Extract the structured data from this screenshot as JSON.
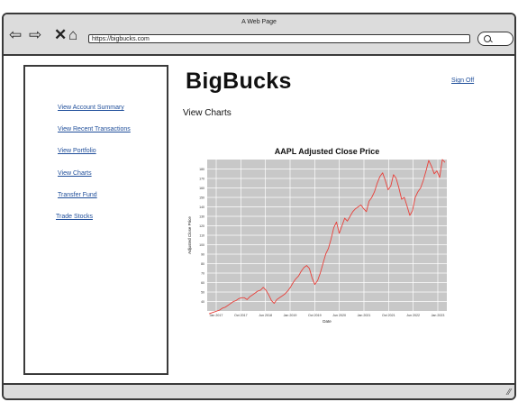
{
  "window": {
    "title": "A Web Page",
    "url": "https://bigbucks.com",
    "nav_icons": [
      "back-arrow-icon",
      "forward-arrow-icon",
      "close-icon",
      "home-icon"
    ]
  },
  "sidebar": {
    "items": [
      {
        "label": "View Account Summary"
      },
      {
        "label": "View Recent Transactions"
      },
      {
        "label": "View Portfolio"
      },
      {
        "label": "View Charts"
      },
      {
        "label": "Transfer Fund"
      },
      {
        "label": "Trade Stocks"
      }
    ]
  },
  "header": {
    "brand": "BigBucks",
    "sign_out": "Sign Off"
  },
  "main": {
    "section_heading": "View Charts"
  },
  "colors": {
    "link": "#1f4e9a",
    "chart_panel": "#c8c8c8",
    "chart_line": "#e8403a",
    "chrome": "#dcdcdc"
  },
  "chart_data": {
    "type": "line",
    "title": "AAPL Adjusted Close Price",
    "xlabel": "Date",
    "ylabel": "Adjusted Close Price",
    "x_ticks": [
      "Jan 2017",
      "Oct 2017",
      "Jun 2018",
      "Jan 2019",
      "Oct 2019",
      "Jun 2020",
      "Jan 2021",
      "Oct 2021",
      "Jun 2022",
      "Jan 2023"
    ],
    "y_ticks": [
      40,
      50,
      60,
      70,
      80,
      90,
      100,
      110,
      120,
      130,
      140,
      150,
      160,
      170,
      180
    ],
    "ylim": [
      30,
      190
    ],
    "grid": true,
    "series": [
      {
        "values": [
          27,
          28,
          29,
          30,
          31,
          33,
          34,
          36,
          38,
          40,
          41,
          43,
          44,
          44,
          42,
          45,
          47,
          49,
          51,
          52,
          55,
          52,
          47,
          41,
          38,
          42,
          44,
          46,
          48,
          51,
          55,
          60,
          64,
          67,
          72,
          76,
          78,
          75,
          65,
          58,
          62,
          70,
          80,
          90,
          96,
          106,
          118,
          124,
          112,
          120,
          128,
          125,
          130,
          135,
          138,
          140,
          142,
          138,
          135,
          146,
          150,
          156,
          165,
          172,
          176,
          168,
          158,
          162,
          174,
          170,
          160,
          148,
          150,
          141,
          131,
          136,
          150,
          156,
          160,
          168,
          178,
          189,
          183,
          175,
          178,
          171,
          190,
          187
        ]
      }
    ]
  }
}
